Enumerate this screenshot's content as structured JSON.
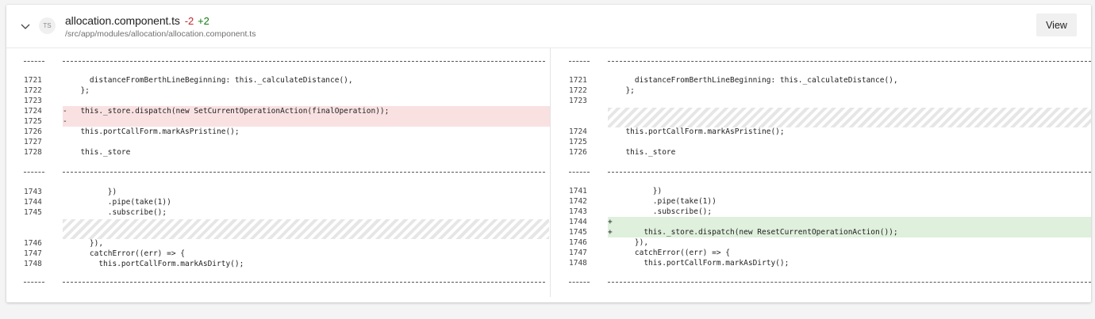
{
  "file": {
    "badge": "TS",
    "name": "allocation.component.ts",
    "deletions": "-2",
    "additions": "+2",
    "path": "/src/app/modules/allocation/allocation.component.ts",
    "view_label": "View"
  },
  "left": {
    "rows": [
      {
        "ln": "1721",
        "code": "    distanceFromBerthLineBeginning: this._calculateDistance(),",
        "type": "ctx"
      },
      {
        "ln": "1722",
        "code": "  };",
        "type": "ctx"
      },
      {
        "ln": "1723",
        "code": "",
        "type": "ctx"
      },
      {
        "ln": "1724",
        "mk": "-",
        "code": "  this._store.dispatch(new SetCurrentOperationAction(finalOperation));",
        "type": "del"
      },
      {
        "ln": "1725",
        "mk": "-",
        "code": "",
        "type": "del"
      },
      {
        "ln": "1726",
        "code": "  this.portCallForm.markAsPristine();",
        "type": "ctx"
      },
      {
        "ln": "1727",
        "code": "",
        "type": "ctx"
      },
      {
        "ln": "1728",
        "code": "  this._store",
        "type": "ctx"
      },
      {
        "ln": "1743",
        "code": "        })",
        "type": "ctx"
      },
      {
        "ln": "1744",
        "code": "        .pipe(take(1))",
        "type": "ctx"
      },
      {
        "ln": "1745",
        "code": "        .subscribe();",
        "type": "ctx"
      },
      {
        "ln": "1746",
        "code": "    }),",
        "type": "ctx"
      },
      {
        "ln": "1747",
        "code": "    catchError((err) => {",
        "type": "ctx"
      },
      {
        "ln": "1748",
        "code": "      this.portCallForm.markAsDirty();",
        "type": "ctx"
      }
    ]
  },
  "right": {
    "rows": [
      {
        "ln": "1721",
        "code": "    distanceFromBerthLineBeginning: this._calculateDistance(),",
        "type": "ctx"
      },
      {
        "ln": "1722",
        "code": "  };",
        "type": "ctx"
      },
      {
        "ln": "1723",
        "code": "",
        "type": "ctx"
      },
      {
        "ln": "1724",
        "code": "  this.portCallForm.markAsPristine();",
        "type": "ctx"
      },
      {
        "ln": "1725",
        "code": "",
        "type": "ctx"
      },
      {
        "ln": "1726",
        "code": "  this._store",
        "type": "ctx"
      },
      {
        "ln": "1741",
        "code": "        })",
        "type": "ctx"
      },
      {
        "ln": "1742",
        "code": "        .pipe(take(1))",
        "type": "ctx"
      },
      {
        "ln": "1743",
        "code": "        .subscribe();",
        "type": "ctx"
      },
      {
        "ln": "1744",
        "mk": "+",
        "code": "",
        "type": "add"
      },
      {
        "ln": "1745",
        "mk": "+",
        "code": "      this._store.dispatch(new ResetCurrentOperationAction());",
        "type": "add"
      },
      {
        "ln": "1746",
        "code": "    }),",
        "type": "ctx"
      },
      {
        "ln": "1747",
        "code": "    catchError((err) => {",
        "type": "ctx"
      },
      {
        "ln": "1748",
        "code": "      this.portCallForm.markAsDirty();",
        "type": "ctx"
      }
    ]
  }
}
